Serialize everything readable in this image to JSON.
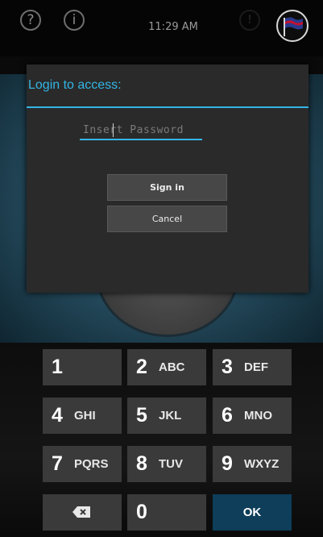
{
  "status_bar": {
    "help_icon": "?",
    "info_icon": "i",
    "time": "11:29 AM",
    "alert_icon": "!",
    "flag_icon": "flag-icon"
  },
  "dialog": {
    "title": "Login to access:",
    "password_placeholder": "Insert Password",
    "password_value": "",
    "sign_in_label": "Sign in",
    "cancel_label": "Cancel"
  },
  "keypad": {
    "keys": [
      {
        "num": "1",
        "letters": ""
      },
      {
        "num": "2",
        "letters": "ABC"
      },
      {
        "num": "3",
        "letters": "DEF"
      },
      {
        "num": "4",
        "letters": "GHI"
      },
      {
        "num": "5",
        "letters": "JKL"
      },
      {
        "num": "6",
        "letters": "MNO"
      },
      {
        "num": "7",
        "letters": "PQRS"
      },
      {
        "num": "8",
        "letters": "TUV"
      },
      {
        "num": "9",
        "letters": "WXYZ"
      },
      {
        "num": "0",
        "letters": ""
      }
    ],
    "ok_label": "OK",
    "backspace_icon": "backspace-icon"
  },
  "colors": {
    "accent": "#33b5e5",
    "ok_key": "#0e3e5a",
    "key_bg": "#3a3a3a"
  }
}
